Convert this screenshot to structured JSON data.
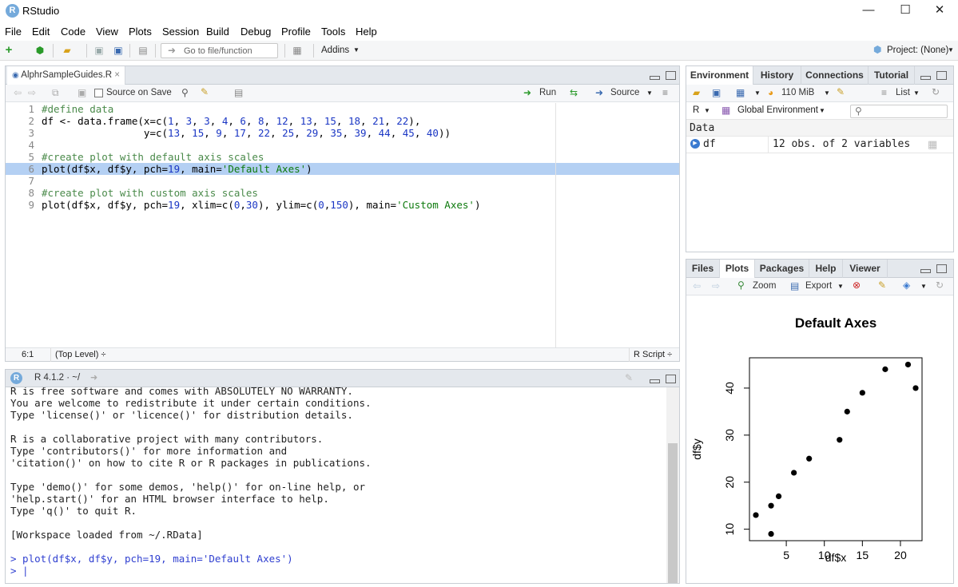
{
  "window": {
    "title": "RStudio",
    "logo": "R",
    "min": "—",
    "max": "☐",
    "close": "✕"
  },
  "menu": [
    "File",
    "Edit",
    "Code",
    "View",
    "Plots",
    "Session",
    "Build",
    "Debug",
    "Profile",
    "Tools",
    "Help"
  ],
  "toolbar": {
    "goto_placeholder": "Go to file/function",
    "addins": "Addins",
    "project": "Project: (None)"
  },
  "editor": {
    "tab": "AlphrSampleGuides.R",
    "source_on_save": "Source on Save",
    "run": "Run",
    "source": "Source",
    "lines": [
      {
        "n": "1",
        "code": [
          {
            "t": "#define data",
            "c": "cm"
          }
        ]
      },
      {
        "n": "2",
        "code": [
          {
            "t": "df <- data.frame(x=c(",
            "c": ""
          },
          {
            "t": "1",
            "c": "num"
          },
          {
            "t": ", ",
            "c": ""
          },
          {
            "t": "3",
            "c": "num"
          },
          {
            "t": ", ",
            "c": ""
          },
          {
            "t": "3",
            "c": "num"
          },
          {
            "t": ", ",
            "c": ""
          },
          {
            "t": "4",
            "c": "num"
          },
          {
            "t": ", ",
            "c": ""
          },
          {
            "t": "6",
            "c": "num"
          },
          {
            "t": ", ",
            "c": ""
          },
          {
            "t": "8",
            "c": "num"
          },
          {
            "t": ", ",
            "c": ""
          },
          {
            "t": "12",
            "c": "num"
          },
          {
            "t": ", ",
            "c": ""
          },
          {
            "t": "13",
            "c": "num"
          },
          {
            "t": ", ",
            "c": ""
          },
          {
            "t": "15",
            "c": "num"
          },
          {
            "t": ", ",
            "c": ""
          },
          {
            "t": "18",
            "c": "num"
          },
          {
            "t": ", ",
            "c": ""
          },
          {
            "t": "21",
            "c": "num"
          },
          {
            "t": ", ",
            "c": ""
          },
          {
            "t": "22",
            "c": "num"
          },
          {
            "t": "),",
            "c": ""
          }
        ]
      },
      {
        "n": "3",
        "code": [
          {
            "t": "                 y=c(",
            "c": ""
          },
          {
            "t": "13",
            "c": "num"
          },
          {
            "t": ", ",
            "c": ""
          },
          {
            "t": "15",
            "c": "num"
          },
          {
            "t": ", ",
            "c": ""
          },
          {
            "t": "9",
            "c": "num"
          },
          {
            "t": ", ",
            "c": ""
          },
          {
            "t": "17",
            "c": "num"
          },
          {
            "t": ", ",
            "c": ""
          },
          {
            "t": "22",
            "c": "num"
          },
          {
            "t": ", ",
            "c": ""
          },
          {
            "t": "25",
            "c": "num"
          },
          {
            "t": ", ",
            "c": ""
          },
          {
            "t": "29",
            "c": "num"
          },
          {
            "t": ", ",
            "c": ""
          },
          {
            "t": "35",
            "c": "num"
          },
          {
            "t": ", ",
            "c": ""
          },
          {
            "t": "39",
            "c": "num"
          },
          {
            "t": ", ",
            "c": ""
          },
          {
            "t": "44",
            "c": "num"
          },
          {
            "t": ", ",
            "c": ""
          },
          {
            "t": "45",
            "c": "num"
          },
          {
            "t": ", ",
            "c": ""
          },
          {
            "t": "40",
            "c": "num"
          },
          {
            "t": "))",
            "c": ""
          }
        ]
      },
      {
        "n": "4",
        "code": []
      },
      {
        "n": "5",
        "code": [
          {
            "t": "#create plot with default axis scales",
            "c": "cm"
          }
        ]
      },
      {
        "n": "6",
        "code": [
          {
            "t": "plot(df$x, df$y, pch=",
            "c": ""
          },
          {
            "t": "19",
            "c": "num"
          },
          {
            "t": ", main=",
            "c": ""
          },
          {
            "t": "'Default Axes'",
            "c": "str"
          },
          {
            "t": ")",
            "c": ""
          }
        ],
        "hl": true
      },
      {
        "n": "7",
        "code": []
      },
      {
        "n": "8",
        "code": [
          {
            "t": "#create plot with custom axis scales",
            "c": "cm"
          }
        ]
      },
      {
        "n": "9",
        "code": [
          {
            "t": "plot(df$x, df$y, pch=",
            "c": ""
          },
          {
            "t": "19",
            "c": "num"
          },
          {
            "t": ", xlim=c(",
            "c": ""
          },
          {
            "t": "0",
            "c": "num"
          },
          {
            "t": ",",
            "c": ""
          },
          {
            "t": "30",
            "c": "num"
          },
          {
            "t": "), ylim=c(",
            "c": ""
          },
          {
            "t": "0",
            "c": "num"
          },
          {
            "t": ",",
            "c": ""
          },
          {
            "t": "150",
            "c": "num"
          },
          {
            "t": "), main=",
            "c": ""
          },
          {
            "t": "'Custom Axes'",
            "c": "str"
          },
          {
            "t": ")",
            "c": ""
          }
        ]
      }
    ],
    "status_pos": "6:1",
    "status_scope": "(Top Level) ÷",
    "status_type": "R Script ÷"
  },
  "console": {
    "version": "R 4.1.2 · ~/",
    "lines": [
      "R is free software and comes with ABSOLUTELY NO WARRANTY.",
      "You are welcome to redistribute it under certain conditions.",
      "Type 'license()' or 'licence()' for distribution details.",
      "",
      "R is a collaborative project with many contributors.",
      "Type 'contributors()' for more information and",
      "'citation()' on how to cite R or R packages in publications.",
      "",
      "Type 'demo()' for some demos, 'help()' for on-line help, or",
      "'help.start()' for an HTML browser interface to help.",
      "Type 'q()' to quit R.",
      "",
      "[Workspace loaded from ~/.RData]",
      ""
    ],
    "command": "> plot(df$x, df$y, pch=19, main='Default Axes')",
    "prompt": "> "
  },
  "env": {
    "tabs": [
      "Environment",
      "History",
      "Connections",
      "Tutorial"
    ],
    "memory": "110 MiB",
    "list": "List",
    "lang": "R",
    "global_env": "Global Environment",
    "section": "Data",
    "rows": [
      {
        "name": "df",
        "value": "12 obs. of 2 variables"
      }
    ]
  },
  "files": {
    "tabs": [
      "Files",
      "Plots",
      "Packages",
      "Help",
      "Viewer"
    ],
    "zoom": "Zoom",
    "export": "Export"
  },
  "chart_data": {
    "type": "scatter",
    "title": "Default Axes",
    "xlabel": "df$x",
    "ylabel": "df$y",
    "x": [
      1,
      3,
      3,
      4,
      6,
      8,
      12,
      13,
      15,
      18,
      21,
      22
    ],
    "y": [
      13,
      15,
      9,
      17,
      22,
      25,
      29,
      35,
      39,
      44,
      45,
      40
    ],
    "xlim": [
      0.16,
      22.84
    ],
    "ylim": [
      7.56,
      46.44
    ],
    "xticks": [
      5,
      10,
      15,
      20
    ],
    "yticks": [
      10,
      20,
      30,
      40
    ],
    "grid": false
  }
}
